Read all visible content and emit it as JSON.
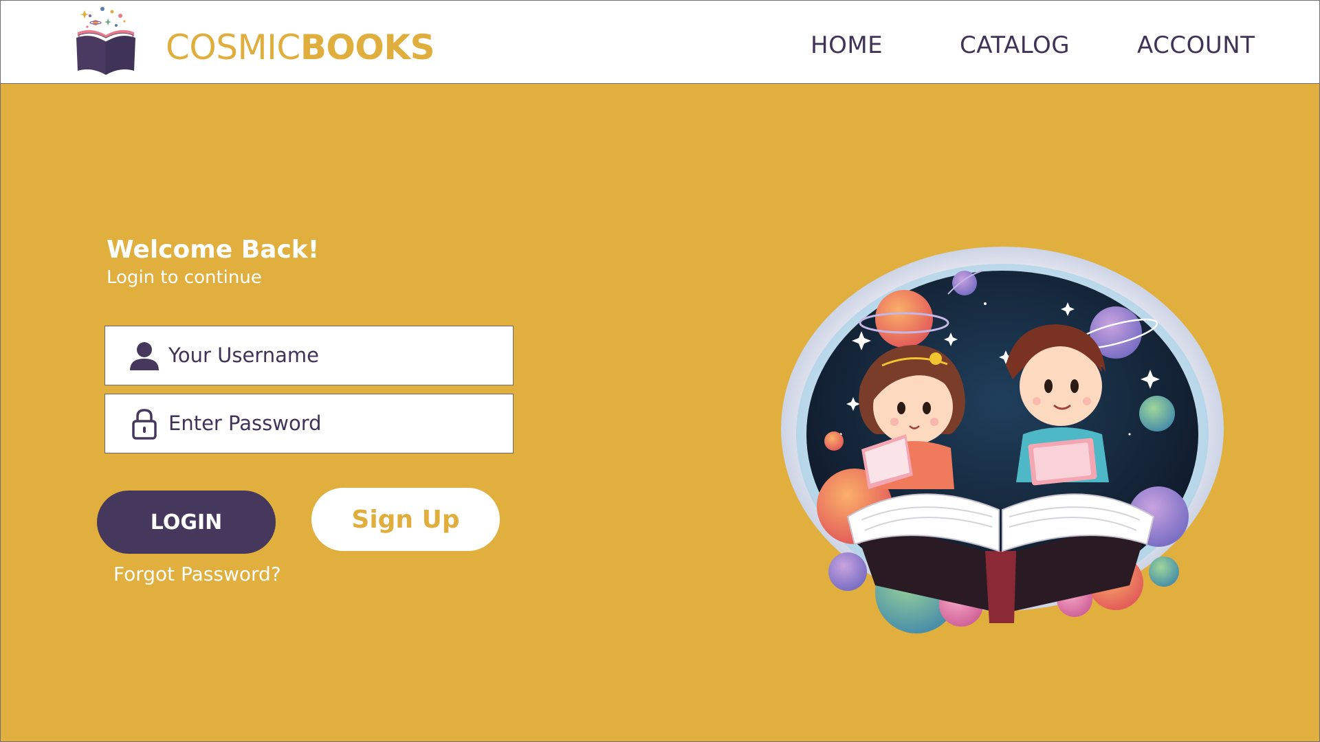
{
  "header": {
    "brand_light": "COSMIC",
    "brand_bold": "BOOKS",
    "logo_icon": "open-book-stars-icon",
    "nav": {
      "home": "HOME",
      "catalog": "CATALOG",
      "account": "ACCOUNT"
    }
  },
  "login": {
    "title": "Welcome Back!",
    "subtitle": "Login to continue",
    "username_placeholder": "Your Username",
    "username_icon": "user-icon",
    "password_placeholder": "Enter Password",
    "password_icon": "lock-icon",
    "login_button": "LOGIN",
    "signup_button": "Sign Up",
    "forgot_link": "Forgot Password?"
  },
  "illustration": {
    "subject": "children-reading-space-book-illustration"
  },
  "colors": {
    "accent": "#e0af3e",
    "brand_text": "#e0ae3c",
    "dark_purple": "#46385c",
    "nav_text": "#3f3358",
    "white": "#ffffff"
  }
}
